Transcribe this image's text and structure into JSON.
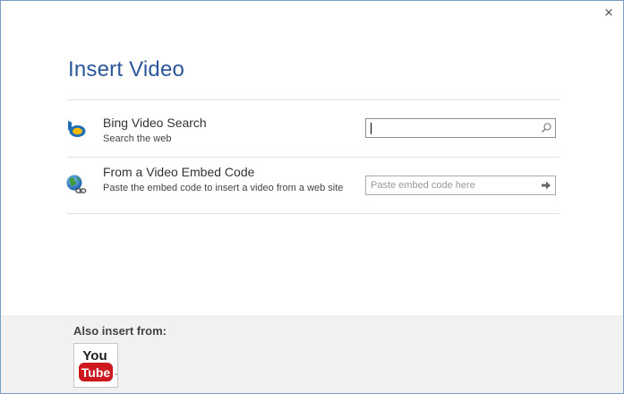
{
  "dialog": {
    "title": "Insert Video",
    "close_label": "×"
  },
  "rows": [
    {
      "title": "Bing Video Search",
      "description": "Search the web",
      "icon": "bing-icon",
      "input_value": "",
      "input_placeholder": "",
      "button_icon": "search-icon"
    },
    {
      "title": "From a Video Embed Code",
      "description": "Paste the embed code to insert a video from a web site",
      "icon": "globe-link-icon",
      "input_value": "",
      "input_placeholder": "Paste embed code here",
      "button_icon": "arrow-right-icon"
    }
  ],
  "footer": {
    "label": "Also insert from:",
    "services": [
      {
        "name": "YouTube",
        "text_top": "You",
        "text_bottom": "Tube",
        "icon": "youtube-logo"
      }
    ]
  },
  "colors": {
    "title": "#2b579a",
    "border": "#7a9fc4",
    "footer_bg": "#f1f1f1",
    "youtube_red": "#cc181e"
  }
}
